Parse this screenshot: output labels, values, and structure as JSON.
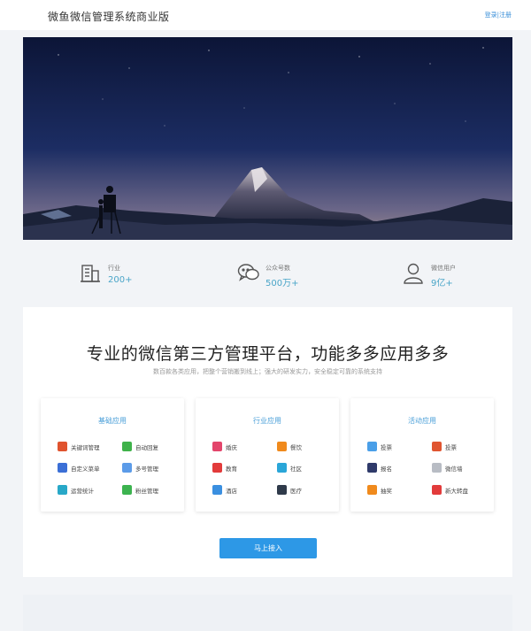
{
  "header": {
    "brand": "微鱼微信管理系统商业版",
    "login": "登录",
    "separator": "|",
    "register": "注册"
  },
  "stats": [
    {
      "label": "行业",
      "value": "200+",
      "icon": "building-icon"
    },
    {
      "label": "公众号数",
      "value": "500万+",
      "icon": "wechat-icon"
    },
    {
      "label": "微信用户",
      "value": "9亿+",
      "icon": "user-icon"
    }
  ],
  "intro": {
    "headline": "专业的微信第三方管理平台，功能多多应用多多",
    "subline": "数百款各类应用，把整个营销搬到线上；强大的研发实力，安全稳定可靠的系统支持"
  },
  "cards": [
    {
      "title": "基础应用",
      "items": [
        {
          "label": "关键词管理",
          "color": "#e0532e"
        },
        {
          "label": "自动回复",
          "color": "#3fb24a"
        },
        {
          "label": "自定义菜单",
          "color": "#3b6fd6"
        },
        {
          "label": "多号管理",
          "color": "#5b9be8"
        },
        {
          "label": "运营统计",
          "color": "#28a8c8"
        },
        {
          "label": "粉丝管理",
          "color": "#3cb34f"
        }
      ]
    },
    {
      "title": "行业应用",
      "items": [
        {
          "label": "婚庆",
          "color": "#e3456b"
        },
        {
          "label": "餐饮",
          "color": "#f08a1c"
        },
        {
          "label": "教育",
          "color": "#e23b3b"
        },
        {
          "label": "社区",
          "color": "#2aa6d8"
        },
        {
          "label": "酒店",
          "color": "#3a8fe0"
        },
        {
          "label": "医疗",
          "color": "#2f3a4a"
        }
      ]
    },
    {
      "title": "活动应用",
      "items": [
        {
          "label": "投票",
          "color": "#4a9fe8"
        },
        {
          "label": "投票",
          "color": "#e05530"
        },
        {
          "label": "报名",
          "color": "#2f3a6a"
        },
        {
          "label": "微信墙",
          "color": "#b8bcc4"
        },
        {
          "label": "抽奖",
          "color": "#f08a1c"
        },
        {
          "label": "新大转盘",
          "color": "#e23b3b"
        }
      ]
    }
  ],
  "cta": {
    "label": "马上接入"
  },
  "colors": {
    "accent": "#2d98e6",
    "stat_value": "#4aa5c8",
    "card_title": "#4a9fd8"
  }
}
